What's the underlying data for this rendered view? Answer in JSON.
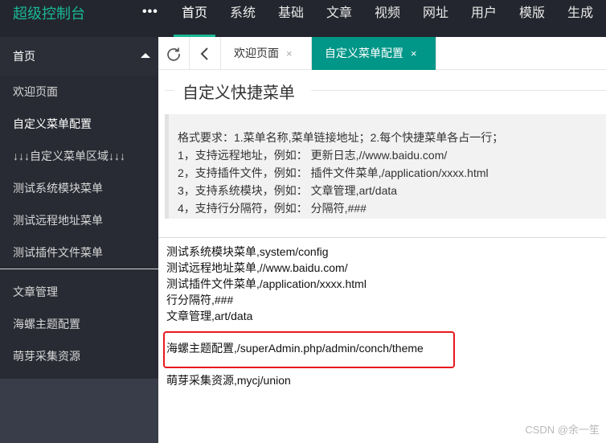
{
  "app": {
    "logo": "超级控制台",
    "more": "•••"
  },
  "topnav": [
    "首页",
    "系统",
    "基础",
    "文章",
    "视频",
    "网址",
    "用户",
    "模版",
    "生成"
  ],
  "sidebar": {
    "header": "首页",
    "group1": [
      "欢迎页面",
      "自定义菜单配置",
      "↓↓↓自定义菜单区域↓↓↓",
      "测试系统模块菜单",
      "测试远程地址菜单",
      "测试插件文件菜单"
    ],
    "group2": [
      "文章管理",
      "海螺主题配置",
      "萌芽采集资源"
    ]
  },
  "tabs": [
    {
      "label": "欢迎页面",
      "close": "×"
    },
    {
      "label": "自定义菜单配置",
      "close": "×"
    }
  ],
  "page": {
    "title": "自定义快捷菜单"
  },
  "help": [
    "格式要求：1.菜单名称,菜单链接地址；2.每个快捷菜单各占一行；",
    "1，支持远程地址，例如： 更新日志,//www.baidu.com/",
    "2，支持插件文件，例如： 插件文件菜单,/application/xxxx.html",
    "3，支持系统模块，例如： 文章管理,art/data",
    "4，支持行分隔符，例如： 分隔符,###"
  ],
  "editor": {
    "lines": [
      "测试系统模块菜单,system/config",
      "测试远程地址菜单,//www.baidu.com/",
      "测试插件文件菜单,/application/xxxx.html",
      "行分隔符,###",
      "文章管理,art/data",
      "",
      "海螺主题配置,/superAdmin.php/admin/conch/theme",
      "",
      "萌芽采集资源,mycj/union"
    ]
  },
  "watermark": "CSDN @余一笙",
  "colors": {
    "accent": "#009688",
    "logo": "#19b797",
    "highlight": "#e8191f"
  }
}
